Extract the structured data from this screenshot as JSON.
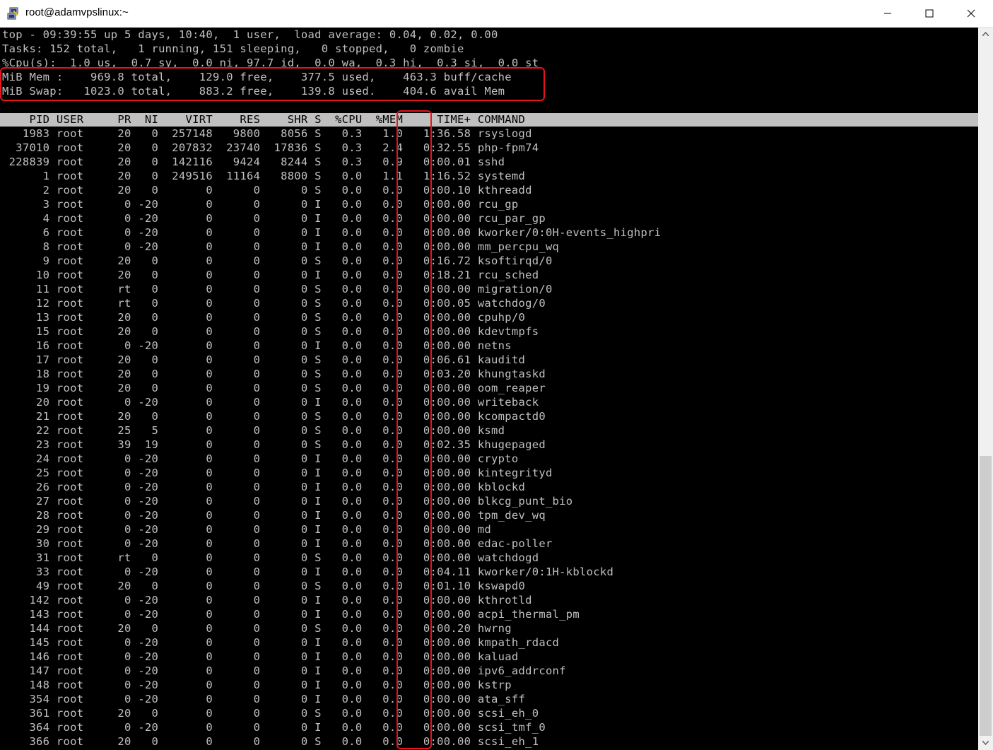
{
  "window": {
    "title": "root@adamvpslinux:~",
    "app_icon": "putty-icon",
    "controls": [
      "minimize-icon",
      "maximize-icon",
      "close-icon"
    ]
  },
  "summary": {
    "uptime_line": "top - 09:39:55 up 5 days, 10:40,  1 user,  load average: 0.04, 0.02, 0.00",
    "tasks_line": "Tasks: 152 total,   1 running, 151 sleeping,   0 stopped,   0 zombie",
    "cpu_line": "%Cpu(s):  1.0 us,  0.7 sy,  0.0 ni, 97.7 id,  0.0 wa,  0.3 hi,  0.3 si,  0.0 st",
    "mem_line": "MiB Mem :    969.8 total,    129.0 free,    377.5 used,    463.3 buff/cache",
    "swap_line": "MiB Swap:   1023.0 total,    883.2 free,    139.8 used.    404.6 avail Mem"
  },
  "columns": [
    "PID",
    "USER",
    "PR",
    "NI",
    "VIRT",
    "RES",
    "SHR",
    "S",
    "%CPU",
    "%MEM",
    "TIME+",
    "COMMAND"
  ],
  "processes": [
    {
      "pid": "1983",
      "user": "root",
      "pr": "20",
      "ni": "0",
      "virt": "257148",
      "res": "9800",
      "shr": "8056",
      "s": "S",
      "cpu": "0.3",
      "mem": "1.0",
      "time": "1:36.58",
      "cmd": "rsyslogd"
    },
    {
      "pid": "37010",
      "user": "root",
      "pr": "20",
      "ni": "0",
      "virt": "207832",
      "res": "23740",
      "shr": "17836",
      "s": "S",
      "cpu": "0.3",
      "mem": "2.4",
      "time": "0:32.55",
      "cmd": "php-fpm74"
    },
    {
      "pid": "228839",
      "user": "root",
      "pr": "20",
      "ni": "0",
      "virt": "142116",
      "res": "9424",
      "shr": "8244",
      "s": "S",
      "cpu": "0.3",
      "mem": "0.9",
      "time": "0:00.01",
      "cmd": "sshd"
    },
    {
      "pid": "1",
      "user": "root",
      "pr": "20",
      "ni": "0",
      "virt": "249516",
      "res": "11164",
      "shr": "8800",
      "s": "S",
      "cpu": "0.0",
      "mem": "1.1",
      "time": "1:16.52",
      "cmd": "systemd"
    },
    {
      "pid": "2",
      "user": "root",
      "pr": "20",
      "ni": "0",
      "virt": "0",
      "res": "0",
      "shr": "0",
      "s": "S",
      "cpu": "0.0",
      "mem": "0.0",
      "time": "0:00.10",
      "cmd": "kthreadd"
    },
    {
      "pid": "3",
      "user": "root",
      "pr": "0",
      "ni": "-20",
      "virt": "0",
      "res": "0",
      "shr": "0",
      "s": "I",
      "cpu": "0.0",
      "mem": "0.0",
      "time": "0:00.00",
      "cmd": "rcu_gp"
    },
    {
      "pid": "4",
      "user": "root",
      "pr": "0",
      "ni": "-20",
      "virt": "0",
      "res": "0",
      "shr": "0",
      "s": "I",
      "cpu": "0.0",
      "mem": "0.0",
      "time": "0:00.00",
      "cmd": "rcu_par_gp"
    },
    {
      "pid": "6",
      "user": "root",
      "pr": "0",
      "ni": "-20",
      "virt": "0",
      "res": "0",
      "shr": "0",
      "s": "I",
      "cpu": "0.0",
      "mem": "0.0",
      "time": "0:00.00",
      "cmd": "kworker/0:0H-events_highpri"
    },
    {
      "pid": "8",
      "user": "root",
      "pr": "0",
      "ni": "-20",
      "virt": "0",
      "res": "0",
      "shr": "0",
      "s": "I",
      "cpu": "0.0",
      "mem": "0.0",
      "time": "0:00.00",
      "cmd": "mm_percpu_wq"
    },
    {
      "pid": "9",
      "user": "root",
      "pr": "20",
      "ni": "0",
      "virt": "0",
      "res": "0",
      "shr": "0",
      "s": "S",
      "cpu": "0.0",
      "mem": "0.0",
      "time": "0:16.72",
      "cmd": "ksoftirqd/0"
    },
    {
      "pid": "10",
      "user": "root",
      "pr": "20",
      "ni": "0",
      "virt": "0",
      "res": "0",
      "shr": "0",
      "s": "I",
      "cpu": "0.0",
      "mem": "0.0",
      "time": "0:18.21",
      "cmd": "rcu_sched"
    },
    {
      "pid": "11",
      "user": "root",
      "pr": "rt",
      "ni": "0",
      "virt": "0",
      "res": "0",
      "shr": "0",
      "s": "S",
      "cpu": "0.0",
      "mem": "0.0",
      "time": "0:00.00",
      "cmd": "migration/0"
    },
    {
      "pid": "12",
      "user": "root",
      "pr": "rt",
      "ni": "0",
      "virt": "0",
      "res": "0",
      "shr": "0",
      "s": "S",
      "cpu": "0.0",
      "mem": "0.0",
      "time": "0:00.05",
      "cmd": "watchdog/0"
    },
    {
      "pid": "13",
      "user": "root",
      "pr": "20",
      "ni": "0",
      "virt": "0",
      "res": "0",
      "shr": "0",
      "s": "S",
      "cpu": "0.0",
      "mem": "0.0",
      "time": "0:00.00",
      "cmd": "cpuhp/0"
    },
    {
      "pid": "15",
      "user": "root",
      "pr": "20",
      "ni": "0",
      "virt": "0",
      "res": "0",
      "shr": "0",
      "s": "S",
      "cpu": "0.0",
      "mem": "0.0",
      "time": "0:00.00",
      "cmd": "kdevtmpfs"
    },
    {
      "pid": "16",
      "user": "root",
      "pr": "0",
      "ni": "-20",
      "virt": "0",
      "res": "0",
      "shr": "0",
      "s": "I",
      "cpu": "0.0",
      "mem": "0.0",
      "time": "0:00.00",
      "cmd": "netns"
    },
    {
      "pid": "17",
      "user": "root",
      "pr": "20",
      "ni": "0",
      "virt": "0",
      "res": "0",
      "shr": "0",
      "s": "S",
      "cpu": "0.0",
      "mem": "0.0",
      "time": "0:06.61",
      "cmd": "kauditd"
    },
    {
      "pid": "18",
      "user": "root",
      "pr": "20",
      "ni": "0",
      "virt": "0",
      "res": "0",
      "shr": "0",
      "s": "S",
      "cpu": "0.0",
      "mem": "0.0",
      "time": "0:03.20",
      "cmd": "khungtaskd"
    },
    {
      "pid": "19",
      "user": "root",
      "pr": "20",
      "ni": "0",
      "virt": "0",
      "res": "0",
      "shr": "0",
      "s": "S",
      "cpu": "0.0",
      "mem": "0.0",
      "time": "0:00.00",
      "cmd": "oom_reaper"
    },
    {
      "pid": "20",
      "user": "root",
      "pr": "0",
      "ni": "-20",
      "virt": "0",
      "res": "0",
      "shr": "0",
      "s": "I",
      "cpu": "0.0",
      "mem": "0.0",
      "time": "0:00.00",
      "cmd": "writeback"
    },
    {
      "pid": "21",
      "user": "root",
      "pr": "20",
      "ni": "0",
      "virt": "0",
      "res": "0",
      "shr": "0",
      "s": "S",
      "cpu": "0.0",
      "mem": "0.0",
      "time": "0:00.00",
      "cmd": "kcompactd0"
    },
    {
      "pid": "22",
      "user": "root",
      "pr": "25",
      "ni": "5",
      "virt": "0",
      "res": "0",
      "shr": "0",
      "s": "S",
      "cpu": "0.0",
      "mem": "0.0",
      "time": "0:00.00",
      "cmd": "ksmd"
    },
    {
      "pid": "23",
      "user": "root",
      "pr": "39",
      "ni": "19",
      "virt": "0",
      "res": "0",
      "shr": "0",
      "s": "S",
      "cpu": "0.0",
      "mem": "0.0",
      "time": "0:02.35",
      "cmd": "khugepaged"
    },
    {
      "pid": "24",
      "user": "root",
      "pr": "0",
      "ni": "-20",
      "virt": "0",
      "res": "0",
      "shr": "0",
      "s": "I",
      "cpu": "0.0",
      "mem": "0.0",
      "time": "0:00.00",
      "cmd": "crypto"
    },
    {
      "pid": "25",
      "user": "root",
      "pr": "0",
      "ni": "-20",
      "virt": "0",
      "res": "0",
      "shr": "0",
      "s": "I",
      "cpu": "0.0",
      "mem": "0.0",
      "time": "0:00.00",
      "cmd": "kintegrityd"
    },
    {
      "pid": "26",
      "user": "root",
      "pr": "0",
      "ni": "-20",
      "virt": "0",
      "res": "0",
      "shr": "0",
      "s": "I",
      "cpu": "0.0",
      "mem": "0.0",
      "time": "0:00.00",
      "cmd": "kblockd"
    },
    {
      "pid": "27",
      "user": "root",
      "pr": "0",
      "ni": "-20",
      "virt": "0",
      "res": "0",
      "shr": "0",
      "s": "I",
      "cpu": "0.0",
      "mem": "0.0",
      "time": "0:00.00",
      "cmd": "blkcg_punt_bio"
    },
    {
      "pid": "28",
      "user": "root",
      "pr": "0",
      "ni": "-20",
      "virt": "0",
      "res": "0",
      "shr": "0",
      "s": "I",
      "cpu": "0.0",
      "mem": "0.0",
      "time": "0:00.00",
      "cmd": "tpm_dev_wq"
    },
    {
      "pid": "29",
      "user": "root",
      "pr": "0",
      "ni": "-20",
      "virt": "0",
      "res": "0",
      "shr": "0",
      "s": "I",
      "cpu": "0.0",
      "mem": "0.0",
      "time": "0:00.00",
      "cmd": "md"
    },
    {
      "pid": "30",
      "user": "root",
      "pr": "0",
      "ni": "-20",
      "virt": "0",
      "res": "0",
      "shr": "0",
      "s": "I",
      "cpu": "0.0",
      "mem": "0.0",
      "time": "0:00.00",
      "cmd": "edac-poller"
    },
    {
      "pid": "31",
      "user": "root",
      "pr": "rt",
      "ni": "0",
      "virt": "0",
      "res": "0",
      "shr": "0",
      "s": "S",
      "cpu": "0.0",
      "mem": "0.0",
      "time": "0:00.00",
      "cmd": "watchdogd"
    },
    {
      "pid": "33",
      "user": "root",
      "pr": "0",
      "ni": "-20",
      "virt": "0",
      "res": "0",
      "shr": "0",
      "s": "I",
      "cpu": "0.0",
      "mem": "0.0",
      "time": "0:04.11",
      "cmd": "kworker/0:1H-kblockd"
    },
    {
      "pid": "49",
      "user": "root",
      "pr": "20",
      "ni": "0",
      "virt": "0",
      "res": "0",
      "shr": "0",
      "s": "S",
      "cpu": "0.0",
      "mem": "0.0",
      "time": "0:01.10",
      "cmd": "kswapd0"
    },
    {
      "pid": "142",
      "user": "root",
      "pr": "0",
      "ni": "-20",
      "virt": "0",
      "res": "0",
      "shr": "0",
      "s": "I",
      "cpu": "0.0",
      "mem": "0.0",
      "time": "0:00.00",
      "cmd": "kthrotld"
    },
    {
      "pid": "143",
      "user": "root",
      "pr": "0",
      "ni": "-20",
      "virt": "0",
      "res": "0",
      "shr": "0",
      "s": "I",
      "cpu": "0.0",
      "mem": "0.0",
      "time": "0:00.00",
      "cmd": "acpi_thermal_pm"
    },
    {
      "pid": "144",
      "user": "root",
      "pr": "20",
      "ni": "0",
      "virt": "0",
      "res": "0",
      "shr": "0",
      "s": "S",
      "cpu": "0.0",
      "mem": "0.0",
      "time": "0:00.20",
      "cmd": "hwrng"
    },
    {
      "pid": "145",
      "user": "root",
      "pr": "0",
      "ni": "-20",
      "virt": "0",
      "res": "0",
      "shr": "0",
      "s": "I",
      "cpu": "0.0",
      "mem": "0.0",
      "time": "0:00.00",
      "cmd": "kmpath_rdacd"
    },
    {
      "pid": "146",
      "user": "root",
      "pr": "0",
      "ni": "-20",
      "virt": "0",
      "res": "0",
      "shr": "0",
      "s": "I",
      "cpu": "0.0",
      "mem": "0.0",
      "time": "0:00.00",
      "cmd": "kaluad"
    },
    {
      "pid": "147",
      "user": "root",
      "pr": "0",
      "ni": "-20",
      "virt": "0",
      "res": "0",
      "shr": "0",
      "s": "I",
      "cpu": "0.0",
      "mem": "0.0",
      "time": "0:00.00",
      "cmd": "ipv6_addrconf"
    },
    {
      "pid": "148",
      "user": "root",
      "pr": "0",
      "ni": "-20",
      "virt": "0",
      "res": "0",
      "shr": "0",
      "s": "I",
      "cpu": "0.0",
      "mem": "0.0",
      "time": "0:00.00",
      "cmd": "kstrp"
    },
    {
      "pid": "354",
      "user": "root",
      "pr": "0",
      "ni": "-20",
      "virt": "0",
      "res": "0",
      "shr": "0",
      "s": "I",
      "cpu": "0.0",
      "mem": "0.0",
      "time": "0:00.00",
      "cmd": "ata_sff"
    },
    {
      "pid": "361",
      "user": "root",
      "pr": "20",
      "ni": "0",
      "virt": "0",
      "res": "0",
      "shr": "0",
      "s": "S",
      "cpu": "0.0",
      "mem": "0.0",
      "time": "0:00.00",
      "cmd": "scsi_eh_0"
    },
    {
      "pid": "364",
      "user": "root",
      "pr": "0",
      "ni": "-20",
      "virt": "0",
      "res": "0",
      "shr": "0",
      "s": "I",
      "cpu": "0.0",
      "mem": "0.0",
      "time": "0:00.00",
      "cmd": "scsi_tmf_0"
    },
    {
      "pid": "366",
      "user": "root",
      "pr": "20",
      "ni": "0",
      "virt": "0",
      "res": "0",
      "shr": "0",
      "s": "S",
      "cpu": "0.0",
      "mem": "0.0",
      "time": "0:00.00",
      "cmd": "scsi_eh_1"
    }
  ],
  "colors": {
    "terminal_bg": "#000000",
    "terminal_fg": "#c0c0c0",
    "header_bar": "#c0c0c0",
    "highlight": "#e8141c"
  }
}
